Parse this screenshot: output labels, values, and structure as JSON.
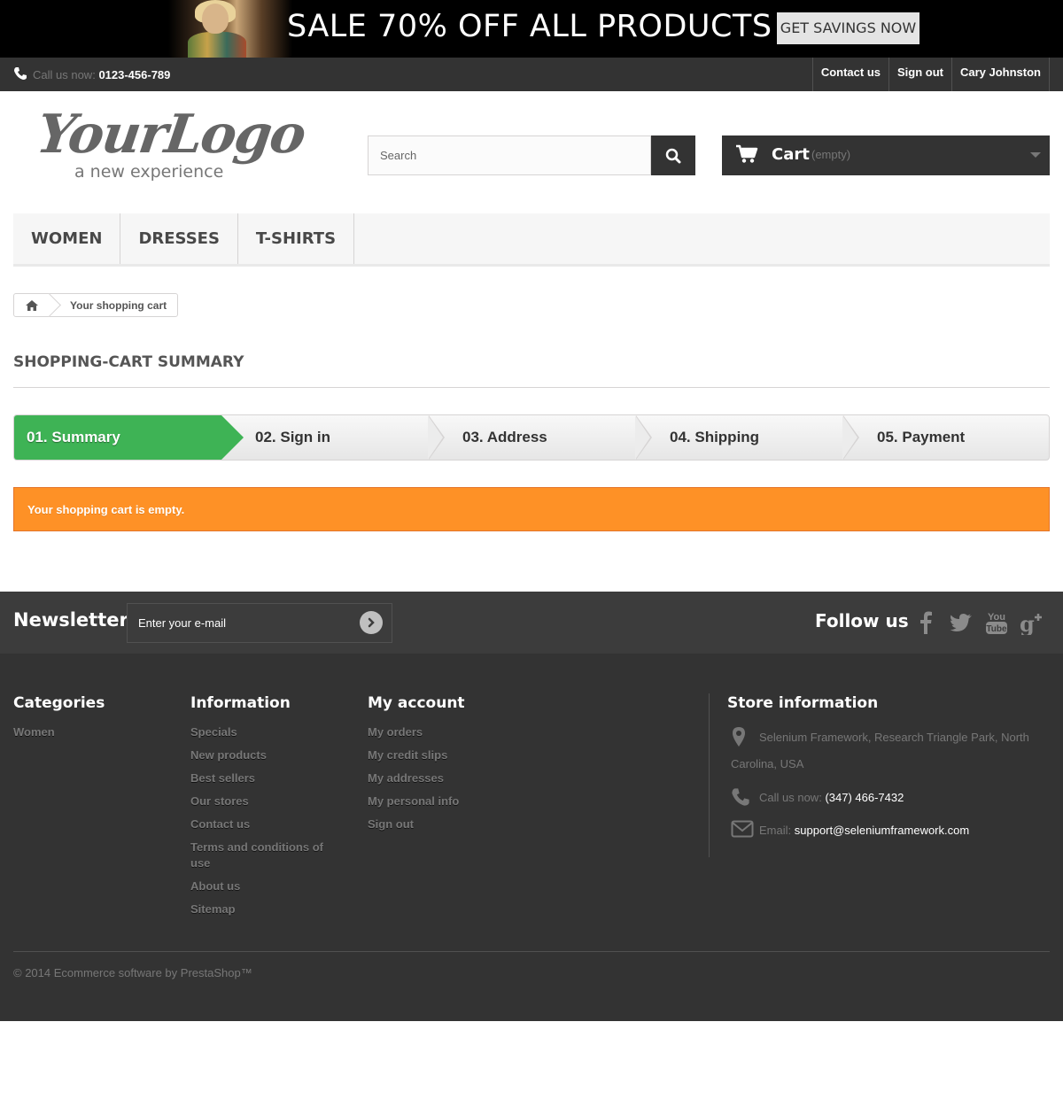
{
  "banner": {
    "headline": "SALE 70% OFF ALL PRODUCTS",
    "cta": "GET SAVINGS NOW"
  },
  "topbar": {
    "call_label": "Call us now:",
    "phone": "0123-456-789",
    "links": [
      "Contact us",
      "Sign out",
      "Cary Johnston"
    ]
  },
  "logo": {
    "main": "YourLogo",
    "tagline": "a new experience"
  },
  "search": {
    "placeholder": "Search",
    "icon": "search-icon"
  },
  "cart": {
    "label": "Cart",
    "status": "(empty)",
    "icon": "cart-icon"
  },
  "menu": {
    "items": [
      "WOMEN",
      "DRESSES",
      "T-SHIRTS"
    ]
  },
  "breadcrumb": {
    "home_icon": "home-icon",
    "current": "Your shopping cart"
  },
  "page": {
    "heading": "SHOPPING-CART SUMMARY"
  },
  "steps": [
    "01. Summary",
    "02. Sign in",
    "03. Address",
    "04. Shipping",
    "05. Payment"
  ],
  "active_step": 0,
  "alert": {
    "text": "Your shopping cart is empty.",
    "color": "#fe9126"
  },
  "newsletter": {
    "title": "Newsletter",
    "placeholder": "Enter your e-mail"
  },
  "follow": {
    "title": "Follow us",
    "networks": [
      "facebook-icon",
      "twitter-icon",
      "youtube-icon",
      "google-plus-icon"
    ]
  },
  "footer": {
    "categories": {
      "title": "Categories",
      "links": [
        "Women"
      ]
    },
    "information": {
      "title": "Information",
      "links": [
        "Specials",
        "New products",
        "Best sellers",
        "Our stores",
        "Contact us",
        "Terms and conditions of use",
        "About us",
        "Sitemap"
      ]
    },
    "account": {
      "title": "My account",
      "links": [
        "My orders",
        "My credit slips",
        "My addresses",
        "My personal info",
        "Sign out"
      ]
    },
    "store": {
      "title": "Store information",
      "address": "Selenium Framework, Research Triangle Park, North Carolina, USA",
      "call_label": "Call us now:",
      "phone": "(347) 466-7432",
      "email_label": "Email:",
      "email": "support@seleniumframework.com"
    },
    "copyright": "© 2014 Ecommerce software by PrestaShop™"
  },
  "colors": {
    "dark": "#333333",
    "active_step": "#3eb355",
    "alert": "#fe9126"
  }
}
